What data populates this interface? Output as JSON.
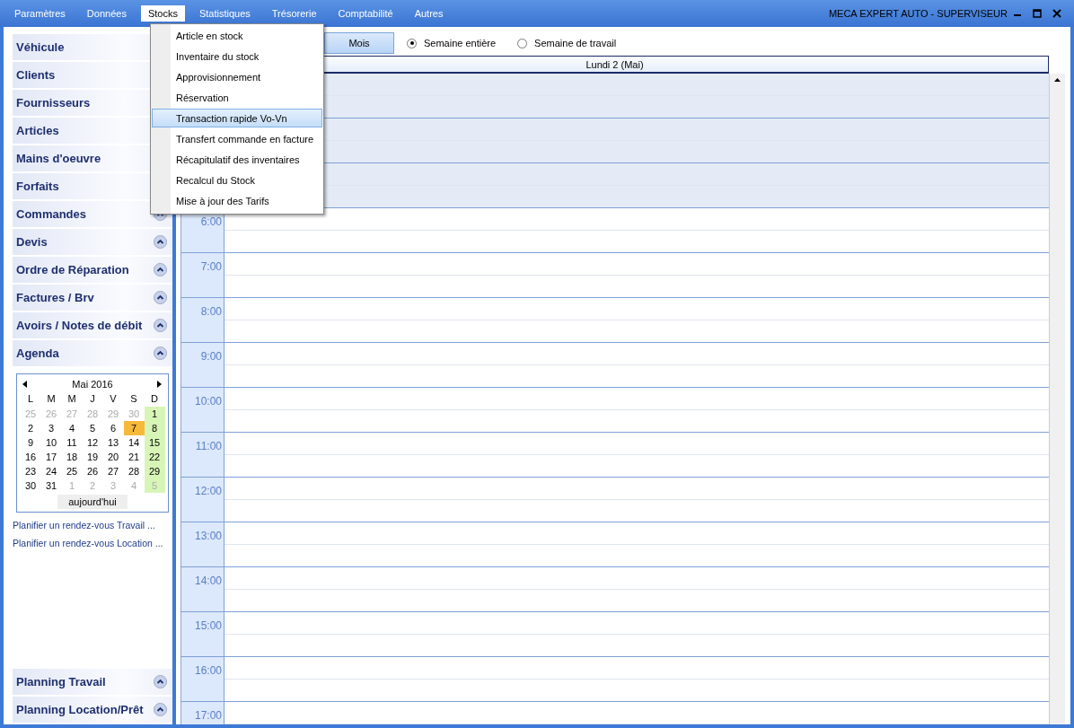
{
  "menubar": {
    "items": [
      {
        "label": "Paramètres",
        "selected": false
      },
      {
        "label": "Données",
        "selected": false
      },
      {
        "label": "Stocks",
        "selected": true
      },
      {
        "label": "Statistiques",
        "selected": false
      },
      {
        "label": "Trésorerie",
        "selected": false
      },
      {
        "label": "Comptabilité",
        "selected": false
      },
      {
        "label": "Autres",
        "selected": false
      }
    ],
    "title": "MECA EXPERT AUTO  -  SUPERVISEUR"
  },
  "dropdown": {
    "items": [
      {
        "label": "Article en stock",
        "selected": false
      },
      {
        "label": "Inventaire du stock",
        "selected": false
      },
      {
        "label": "Approvisionnement",
        "selected": false
      },
      {
        "label": "Réservation",
        "selected": false
      },
      {
        "label": "Transaction rapide Vo-Vn",
        "selected": true
      },
      {
        "label": "Transfert commande en facture",
        "selected": false
      },
      {
        "label": "Récapitulatif des inventaires",
        "selected": false
      },
      {
        "label": "Recalcul du Stock",
        "selected": false
      },
      {
        "label": "Mise à jour des Tarifs",
        "selected": false
      }
    ]
  },
  "sidebar": {
    "items": [
      {
        "label": "Véhicule"
      },
      {
        "label": "Clients"
      },
      {
        "label": "Fournisseurs"
      },
      {
        "label": "Articles"
      },
      {
        "label": "Mains d'oeuvre"
      },
      {
        "label": "Forfaits"
      },
      {
        "label": "Commandes",
        "collapsible": true
      },
      {
        "label": "Devis",
        "collapsible": true
      },
      {
        "label": "Ordre de Réparation",
        "collapsible": true
      },
      {
        "label": "Factures / Brv",
        "collapsible": true
      },
      {
        "label": "Avoirs / Notes de débit",
        "collapsible": true
      },
      {
        "label": "Agenda",
        "collapsible": true
      }
    ],
    "calendar": {
      "month": "Mai 2016",
      "weekdays": [
        "L",
        "M",
        "M",
        "J",
        "V",
        "S",
        "D"
      ],
      "weeks": [
        [
          {
            "day": "25",
            "other_month": true,
            "today": false
          },
          {
            "day": "26",
            "other_month": true,
            "today": false
          },
          {
            "day": "27",
            "other_month": true,
            "today": false
          },
          {
            "day": "28",
            "other_month": true,
            "today": false
          },
          {
            "day": "29",
            "other_month": true,
            "today": false
          },
          {
            "day": "30",
            "other_month": true,
            "today": false
          },
          {
            "day": "1",
            "other_month": false,
            "today": false
          }
        ],
        [
          {
            "day": "2",
            "other_month": false,
            "today": false
          },
          {
            "day": "3",
            "other_month": false,
            "today": false
          },
          {
            "day": "4",
            "other_month": false,
            "today": false
          },
          {
            "day": "5",
            "other_month": false,
            "today": false
          },
          {
            "day": "6",
            "other_month": false,
            "today": false
          },
          {
            "day": "7",
            "other_month": false,
            "today": true
          },
          {
            "day": "8",
            "other_month": false,
            "today": false
          }
        ],
        [
          {
            "day": "9",
            "other_month": false,
            "today": false
          },
          {
            "day": "10",
            "other_month": false,
            "today": false
          },
          {
            "day": "11",
            "other_month": false,
            "today": false
          },
          {
            "day": "12",
            "other_month": false,
            "today": false
          },
          {
            "day": "13",
            "other_month": false,
            "today": false
          },
          {
            "day": "14",
            "other_month": false,
            "today": false
          },
          {
            "day": "15",
            "other_month": false,
            "today": false
          }
        ],
        [
          {
            "day": "16",
            "other_month": false,
            "today": false
          },
          {
            "day": "17",
            "other_month": false,
            "today": false
          },
          {
            "day": "18",
            "other_month": false,
            "today": false
          },
          {
            "day": "19",
            "other_month": false,
            "today": false
          },
          {
            "day": "20",
            "other_month": false,
            "today": false
          },
          {
            "day": "21",
            "other_month": false,
            "today": false
          },
          {
            "day": "22",
            "other_month": false,
            "today": false
          }
        ],
        [
          {
            "day": "23",
            "other_month": false,
            "today": false
          },
          {
            "day": "24",
            "other_month": false,
            "today": false
          },
          {
            "day": "25",
            "other_month": false,
            "today": false
          },
          {
            "day": "26",
            "other_month": false,
            "today": false
          },
          {
            "day": "27",
            "other_month": false,
            "today": false
          },
          {
            "day": "28",
            "other_month": false,
            "today": false
          },
          {
            "day": "29",
            "other_month": false,
            "today": false
          }
        ],
        [
          {
            "day": "30",
            "other_month": false,
            "today": false
          },
          {
            "day": "31",
            "other_month": false,
            "today": false
          },
          {
            "day": "1",
            "other_month": true,
            "today": false
          },
          {
            "day": "2",
            "other_month": true,
            "today": false
          },
          {
            "day": "3",
            "other_month": true,
            "today": false
          },
          {
            "day": "4",
            "other_month": true,
            "today": false
          },
          {
            "day": "5",
            "other_month": true,
            "today": false
          }
        ]
      ],
      "today_button": "aujourd'hui"
    },
    "links": [
      "Planifier un rendez-vous Travail ...",
      "Planifier un rendez-vous Location ..."
    ],
    "bottom_items": [
      {
        "label": "Planning Travail",
        "collapsible": true
      },
      {
        "label": "Planning Location/Prêt",
        "collapsible": true
      }
    ]
  },
  "agenda": {
    "view_button": "Mois",
    "options": [
      {
        "label": "Semaine entière",
        "selected": true
      },
      {
        "label": "Semaine de travail",
        "selected": false
      }
    ],
    "day_header": "Lundi 2 (Mai)",
    "hours": [
      {
        "off_hours": true
      },
      {
        "off_hours": true
      },
      {
        "off_hours": true
      },
      {
        "label": "6:00",
        "off_hours": false
      },
      {
        "label": "7:00",
        "off_hours": false
      },
      {
        "label": "8:00",
        "off_hours": false
      },
      {
        "label": "9:00",
        "off_hours": false
      },
      {
        "label": "10:00",
        "off_hours": false
      },
      {
        "label": "11:00",
        "off_hours": false
      },
      {
        "label": "12:00",
        "off_hours": false
      },
      {
        "label": "13:00",
        "off_hours": false
      },
      {
        "label": "14:00",
        "off_hours": false
      },
      {
        "label": "15:00",
        "off_hours": false
      },
      {
        "label": "16:00",
        "off_hours": false
      },
      {
        "label": "17:00",
        "off_hours": false
      }
    ]
  }
}
